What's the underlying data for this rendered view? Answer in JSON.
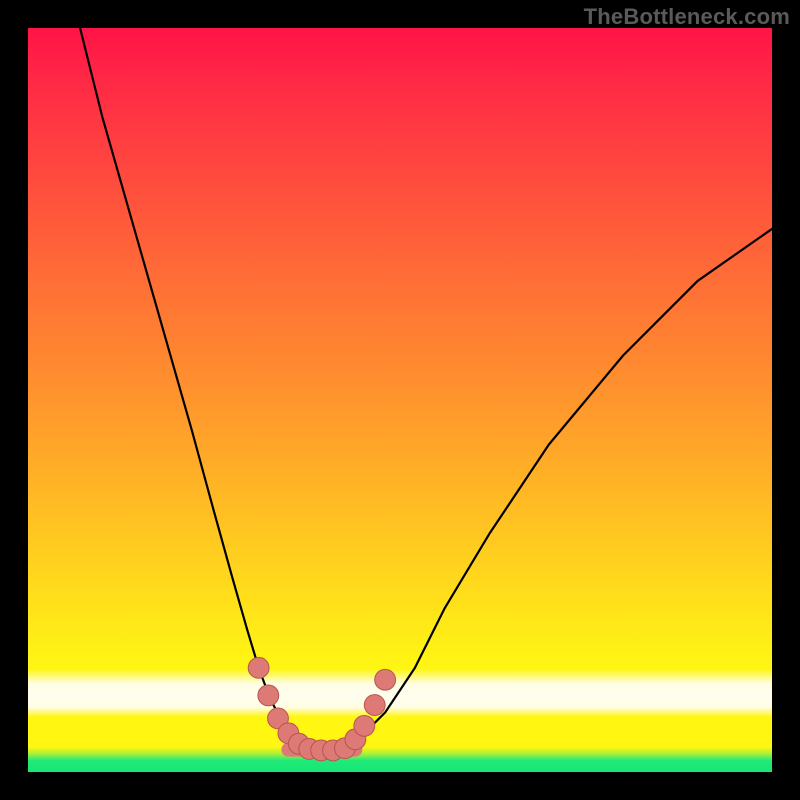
{
  "watermark": {
    "text": "TheBottleneck.com"
  },
  "colors": {
    "background": "#000000",
    "gradient_top": "#ff1447",
    "gradient_mid": "#ffb026",
    "gradient_low": "#fff611",
    "pale_band": "#fffde2",
    "green_strip": "#1fe879",
    "curve": "#000000",
    "marker": "#dd7a76",
    "marker_edge": "#b75450"
  },
  "chart_data": {
    "type": "line",
    "title": "",
    "xlabel": "",
    "ylabel": "",
    "xlim": [
      0,
      100
    ],
    "ylim": [
      0,
      100
    ],
    "grid": false,
    "legend": false,
    "notes": "Axes are unlabeled percentages (0–100). y=100 at top, y=0 at bottom. Single V-shaped curve with a flat trough near the bottom; salmon markers highlight the trough region.",
    "series": [
      {
        "name": "curve",
        "x": [
          7,
          10,
          14,
          18,
          22,
          25,
          27.5,
          29.5,
          31,
          32.5,
          34,
          35.5,
          37,
          38,
          41,
          43,
          45,
          48,
          52,
          56,
          62,
          70,
          80,
          90,
          100
        ],
        "y": [
          100,
          88,
          74,
          60,
          46,
          35,
          26,
          19,
          14,
          10,
          7,
          5,
          3.5,
          3,
          3,
          3.5,
          5,
          8,
          14,
          22,
          32,
          44,
          56,
          66,
          73
        ]
      }
    ],
    "markers": {
      "name": "trough-markers",
      "points": [
        {
          "x": 31.0,
          "y": 14.0
        },
        {
          "x": 32.3,
          "y": 10.3
        },
        {
          "x": 33.6,
          "y": 7.2
        },
        {
          "x": 35.0,
          "y": 5.2
        },
        {
          "x": 36.4,
          "y": 3.8
        },
        {
          "x": 37.8,
          "y": 3.1
        },
        {
          "x": 39.4,
          "y": 2.9
        },
        {
          "x": 41.0,
          "y": 2.9
        },
        {
          "x": 42.6,
          "y": 3.2
        },
        {
          "x": 44.0,
          "y": 4.4
        },
        {
          "x": 45.2,
          "y": 6.2
        },
        {
          "x": 46.6,
          "y": 9.0
        },
        {
          "x": 48.0,
          "y": 12.4
        }
      ],
      "radius_pct": 1.4
    },
    "trough_band": {
      "from_x": 35.0,
      "to_x": 44.0,
      "y": 3.0
    }
  }
}
